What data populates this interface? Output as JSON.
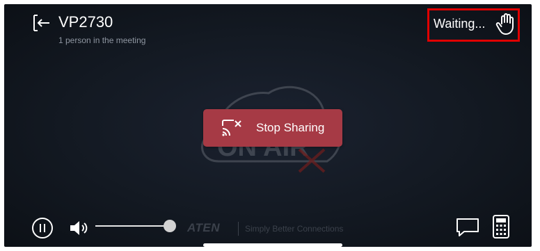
{
  "header": {
    "title": "VP2730",
    "subtitle": "1 person in the meeting",
    "back_icon": "back-arrow-icon"
  },
  "status": {
    "text": "Waiting...",
    "icon": "raise-hand-icon",
    "highlight_color": "#e00000"
  },
  "stage": {
    "background_art": "on-air-cloud-icon",
    "stop_sharing": {
      "label": "Stop Sharing",
      "icon": "cast-off-icon",
      "color": "#a63a45"
    }
  },
  "controls": {
    "play_pause_icon": "pause-icon",
    "volume_icon": "speaker-icon",
    "volume_level": 1.0,
    "chat_icon": "chat-icon",
    "keypad_icon": "keypad-icon"
  },
  "branding": {
    "logo": "ATEN",
    "tagline": "Simply Better Connections"
  }
}
